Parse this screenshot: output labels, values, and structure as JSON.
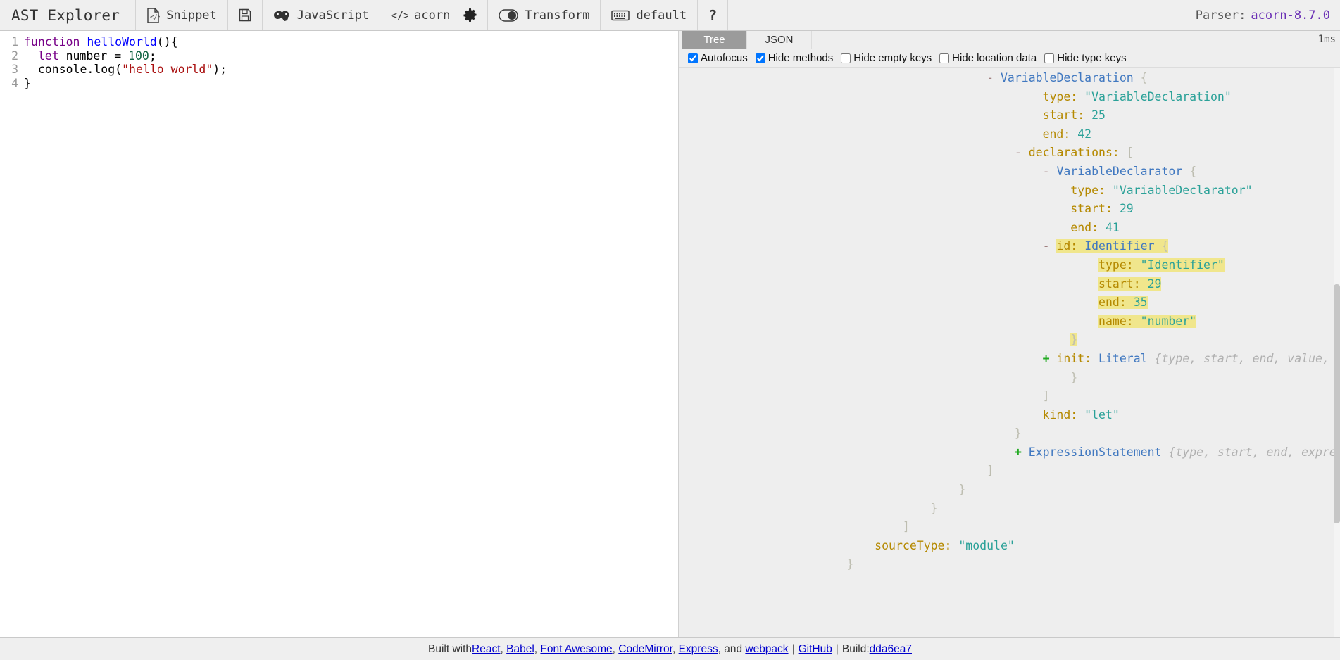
{
  "app": {
    "title": "AST Explorer"
  },
  "toolbar": {
    "snippet": {
      "label": "Snippet",
      "icon": "code-file-icon"
    },
    "save": {
      "icon": "save-icon"
    },
    "language": {
      "label": "JavaScript",
      "icon": "javascript-infinity-icon"
    },
    "parser": {
      "label": "acorn",
      "icon": "code-brackets-icon"
    },
    "settings": {
      "icon": "gear-icon"
    },
    "transform": {
      "label": "Transform",
      "icon": "toggle-icon"
    },
    "keymap": {
      "label": "default",
      "icon": "keyboard-icon"
    },
    "help": {
      "label": "?",
      "icon": "question-mark-icon"
    }
  },
  "parser_info": {
    "prefix": "Parser:",
    "version": "acorn-8.7.0"
  },
  "editor": {
    "lines": [
      {
        "num": "1",
        "text": "function helloWorld(){"
      },
      {
        "num": "2",
        "text": "  let number = 100;"
      },
      {
        "num": "3",
        "text": "  console.log(\"hello world\");"
      },
      {
        "num": "4",
        "text": "}"
      }
    ]
  },
  "tabs": [
    {
      "label": "Tree",
      "active": true
    },
    {
      "label": "JSON",
      "active": false
    }
  ],
  "timing": "1ms",
  "options": [
    {
      "label": "Autofocus",
      "checked": true
    },
    {
      "label": "Hide methods",
      "checked": true
    },
    {
      "label": "Hide empty keys",
      "checked": false
    },
    {
      "label": "Hide location data",
      "checked": false
    },
    {
      "label": "Hide type keys",
      "checked": false
    }
  ],
  "tree_lines": [
    {
      "indent": 11,
      "toggle": "-",
      "node": "VariableDeclaration",
      "brace": "{"
    },
    {
      "indent": 13,
      "key": "type",
      "str": "\"VariableDeclaration\""
    },
    {
      "indent": 13,
      "key": "start",
      "num": "25"
    },
    {
      "indent": 13,
      "key": "end",
      "num": "42"
    },
    {
      "indent": 12,
      "toggle": "-",
      "key": "declarations",
      "brace": "["
    },
    {
      "indent": 13,
      "toggle": "-",
      "node": "VariableDeclarator",
      "brace": "{"
    },
    {
      "indent": 14,
      "key": "type",
      "str": "\"VariableDeclarator\""
    },
    {
      "indent": 14,
      "key": "start",
      "num": "29"
    },
    {
      "indent": 14,
      "key": "end",
      "num": "41"
    },
    {
      "indent": 13,
      "toggle": "-",
      "key": "id",
      "node": "Identifier",
      "brace": "{",
      "highlight": true
    },
    {
      "indent": 15,
      "key": "type",
      "str": "\"Identifier\"",
      "highlight": true
    },
    {
      "indent": 15,
      "key": "start",
      "num": "29",
      "highlight": true
    },
    {
      "indent": 15,
      "key": "end",
      "num": "35",
      "highlight": true
    },
    {
      "indent": 15,
      "key": "name",
      "str": "\"number\"",
      "highlight": true
    },
    {
      "indent": 14,
      "brace": "}",
      "highlight": true
    },
    {
      "indent": 13,
      "toggle": "+",
      "key": "init",
      "node": "Literal",
      "preview": "{type, start, end, value, raw}"
    },
    {
      "indent": 14,
      "brace": "}"
    },
    {
      "indent": 13,
      "brace": "]"
    },
    {
      "indent": 13,
      "key": "kind",
      "str": "\"let\""
    },
    {
      "indent": 12,
      "brace": "}"
    },
    {
      "indent": 12,
      "toggle": "+",
      "node": "ExpressionStatement",
      "preview": "{type, start, end, expression}"
    },
    {
      "indent": 11,
      "brace": "]"
    },
    {
      "indent": 10,
      "brace": "}"
    },
    {
      "indent": 9,
      "brace": "}"
    },
    {
      "indent": 8,
      "brace": "]"
    },
    {
      "indent": 7,
      "key": "sourceType",
      "str": "\"module\""
    },
    {
      "indent": 6,
      "brace": "}"
    }
  ],
  "footer": {
    "built_with": "Built with ",
    "links": [
      {
        "label": "React",
        "after": ", "
      },
      {
        "label": "Babel",
        "after": ", "
      },
      {
        "label": "Font Awesome",
        "after": ", "
      },
      {
        "label": "CodeMirror",
        "after": ", "
      },
      {
        "label": "Express",
        "after": ", and "
      },
      {
        "label": "webpack",
        "after": ""
      }
    ],
    "sep1": " | ",
    "github": "GitHub",
    "sep2": " | ",
    "build_label": " Build: ",
    "build_hash": "dda6ea7"
  },
  "colors": {
    "accent_tab": "#9b9b9b",
    "highlight": "#f0e68c",
    "node": "#4078c0",
    "key": "#b58900",
    "string": "#2aa198",
    "link": "#0000cc",
    "parser_link": "#6a2fb5"
  }
}
